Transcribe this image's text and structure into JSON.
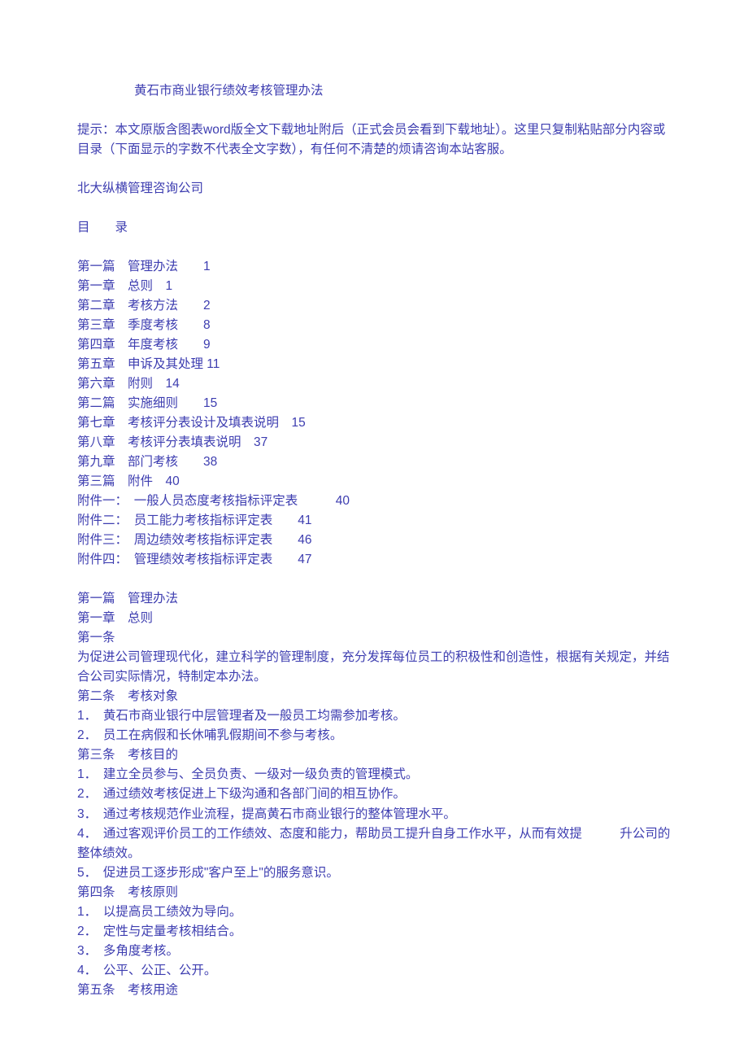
{
  "title": "黄石市商业银行绩效考核管理办法",
  "notice": "提示：本文原版含图表word版全文下载地址附后（正式会员会看到下载地址）。这里只复制粘贴部分内容或目录（下面显示的字数不代表全文字数），有任何不清楚的烦请咨询本站客服。",
  "source": "北大纵横管理咨询公司",
  "toc_heading": "目　　录",
  "toc_lines": [
    "第一篇　管理办法　　1",
    "第一章　总则　1",
    "第二章　考核方法　　2",
    "第三章　季度考核　　8",
    "第四章　年度考核　　9",
    "第五章　申诉及其处理 11",
    "第六章　附则　14",
    "第二篇　实施细则　　15",
    "第七章　考核评分表设计及填表说明　15",
    "第八章　考核评分表填表说明　37",
    "第九章　部门考核　　38",
    "第三篇　附件　40",
    "附件一：　一般人员态度考核指标评定表　　　40",
    "附件二：　员工能力考核指标评定表　　41",
    "附件三：　周边绩效考核指标评定表　　46",
    "附件四：　管理绩效考核指标评定表　　47"
  ],
  "body_lines": [
    {
      "text": "第一篇　管理办法",
      "wrap": false
    },
    {
      "text": "第一章　总则",
      "wrap": false
    },
    {
      "text": "第一条",
      "wrap": false
    },
    {
      "text": "为促进公司管理现代化，建立科学的管理制度，充分发挥每位员工的积极性和创造性，根据有关规定，并结合公司实际情况，特制定本办法。",
      "wrap": true
    },
    {
      "text": "第二条　考核对象",
      "wrap": false
    },
    {
      "text": "1．　黄石市商业银行中层管理者及一般员工均需参加考核。",
      "wrap": false
    },
    {
      "text": "2．　员工在病假和长休哺乳假期间不参与考核。",
      "wrap": false
    },
    {
      "text": "第三条　考核目的",
      "wrap": false
    },
    {
      "text": "1．　建立全员参与、全员负责、一级对一级负责的管理模式。",
      "wrap": false
    },
    {
      "text": "2．　通过绩效考核促进上下级沟通和各部门间的相互协作。",
      "wrap": false
    },
    {
      "text": "3．　通过考核规范作业流程，提高黄石市商业银行的整体管理水平。",
      "wrap": false
    },
    {
      "text": "4．　通过客观评价员工的工作绩效、态度和能力，帮助员工提升自身工作水平，从而有效提　　　升公司的整体绩效。",
      "wrap": true
    },
    {
      "text": "5．　促进员工逐步形成\"客户至上\"的服务意识。",
      "wrap": false
    },
    {
      "text": "第四条　考核原则",
      "wrap": false
    },
    {
      "text": "1．　以提高员工绩效为导向。",
      "wrap": false
    },
    {
      "text": "2．　定性与定量考核相结合。",
      "wrap": false
    },
    {
      "text": "3．　多角度考核。",
      "wrap": false
    },
    {
      "text": "4．　公平、公正、公开。",
      "wrap": false
    },
    {
      "text": "第五条　考核用途",
      "wrap": false
    }
  ]
}
